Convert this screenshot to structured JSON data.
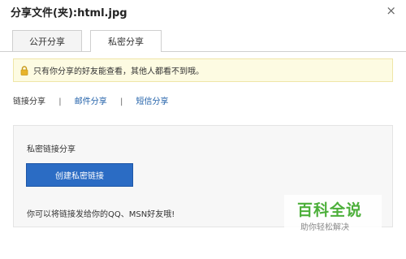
{
  "dialog": {
    "title": "分享文件(夹):html.jpg",
    "close_glyph": "×"
  },
  "tabs": [
    {
      "label": "公开分享",
      "active": false
    },
    {
      "label": "私密分享",
      "active": true
    }
  ],
  "notice": {
    "icon": "lock-icon",
    "text": "只有你分享的好友能查看，其他人都看不到哦。",
    "background": "#fdfbe2"
  },
  "share_links": [
    {
      "label": "链接分享",
      "active": true
    },
    {
      "label": "邮件分享",
      "active": false
    },
    {
      "label": "短信分享",
      "active": false
    }
  ],
  "separator": "|",
  "panel": {
    "title": "私密链接分享",
    "button_label": "创建私密链接",
    "hint": "你可以将链接发给你的QQ、MSN好友哦!"
  },
  "watermark": {
    "brand": "百科全说",
    "slogan": "助你轻松解决"
  },
  "colors": {
    "accent": "#2b6cc4",
    "link": "#1f5fa8",
    "watermark": "#4caf3a"
  }
}
